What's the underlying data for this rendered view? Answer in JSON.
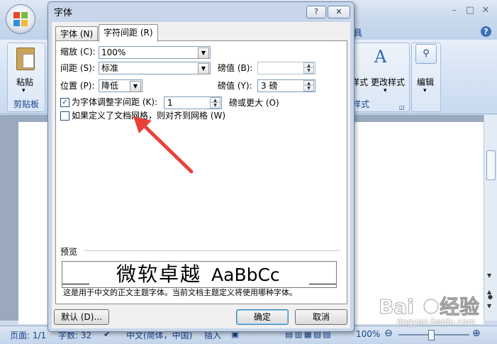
{
  "window": {
    "title": ""
  },
  "ribbon": {
    "tab_tools": "具",
    "paste_label": "粘贴",
    "clipboard_group": "剪贴板",
    "style_label": "样式",
    "change_style_label": "更改样式",
    "styles_group": "样式",
    "edit_label": "编辑"
  },
  "dialog": {
    "title": "字体",
    "help_glyph": "?",
    "close_glyph": "✕",
    "tabs": [
      {
        "label": "字体 (N)",
        "active": false
      },
      {
        "label": "字符间距 (R)",
        "active": true
      }
    ],
    "scale": {
      "label": "缩放 (C):",
      "value": "100%"
    },
    "spacing": {
      "label": "间距 (S):",
      "value": "标准",
      "by_label": "磅值 (B):",
      "by_value": ""
    },
    "position": {
      "label": "位置 (P):",
      "value": "降低",
      "by_label": "磅值 (Y):",
      "by_value": "3 磅"
    },
    "kerning": {
      "label": "为字体调整字间距 (K):",
      "checked": true,
      "value": "1",
      "suffix": "磅或更大 (O)"
    },
    "snap_grid": {
      "label": "如果定义了文档网格，则对齐到网格 (W)",
      "checked": false
    },
    "preview": {
      "label": "预览",
      "sample_cjk": "微软卓越",
      "sample_latin": "AaBbCc",
      "description": "这是用于中文的正文主题字体。当前文档主题定义将使用哪种字体。"
    },
    "buttons": {
      "default": "默认 (D)...",
      "ok": "确定",
      "cancel": "取消"
    }
  },
  "status_bar": {
    "page": "页面: 1/1",
    "words": "字数: 32",
    "language": "中文(简体，中国)",
    "insert_mode": "插入",
    "zoom": "100%",
    "zoom_level": 0.5
  },
  "watermark": {
    "brand": "Bai du 经验",
    "url": "jingyan.baidu.com"
  },
  "colors": {
    "accent": "#15428b",
    "arrow": "#e8413a"
  }
}
